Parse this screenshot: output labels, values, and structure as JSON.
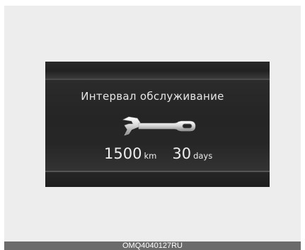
{
  "display": {
    "title": "Интервал обслуживание",
    "distance_value": "1500",
    "distance_unit": "km",
    "days_value": "30",
    "days_unit": "days",
    "icon": "wrench-icon"
  },
  "caption": "OMQ4040127RU",
  "colors": {
    "frame_bg": "#ededed",
    "display_bg": "#151515",
    "text": "#e6e6e6",
    "caption_bg": "#6b6b6b"
  }
}
